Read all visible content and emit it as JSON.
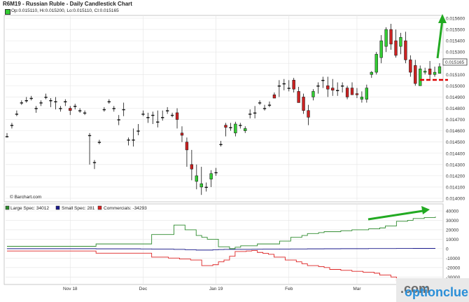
{
  "header": {
    "title": "R6M19 - Russian Ruble - Daily Candlestick Chart",
    "ohlc": "Op:0.015110, Hi:0.015200, Lo:0.015110, Cl:0.015165"
  },
  "price_tag": "0.015165",
  "credit": "© Barchart.com",
  "watermark": {
    "brand": "optionclue",
    "tld": ".com"
  },
  "colors": {
    "up": "#33cc33",
    "down": "#cc2222",
    "large_spec": "#2e8b2e",
    "small_spec": "#1a1a8c",
    "commercials": "#dd2222",
    "arrow": "#22aa22",
    "support": "#dd0000"
  },
  "chart_data": [
    {
      "type": "candlestick",
      "title": "R6M19 - Russian Ruble - Daily Candlestick Chart",
      "x_tick_labels": [
        "Nov 18",
        "Dec",
        "Jan 19",
        "Feb",
        "Mar"
      ],
      "ylim": [
        0.014,
        0.0156
      ],
      "y_ticks": [
        "0.015600",
        "0.015500",
        "0.015400",
        "0.015300",
        "0.015200",
        "0.015100",
        "0.015000",
        "0.014900",
        "0.014800",
        "0.014700",
        "0.014600",
        "0.014500",
        "0.014400",
        "0.014300",
        "0.014200",
        "0.014100",
        "0.014000"
      ],
      "grid": true,
      "ohlc": [
        [
          0.01455,
          0.01458,
          0.01454,
          0.01455
        ],
        [
          0.01465,
          0.01467,
          0.01462,
          0.01465
        ],
        [
          0.01475,
          0.01478,
          0.01473,
          0.01475
        ],
        [
          0.01485,
          0.01487,
          0.01483,
          0.01485
        ],
        [
          0.01487,
          0.0149,
          0.01485,
          0.01487
        ],
        [
          0.01489,
          0.01491,
          0.01487,
          0.01489
        ],
        [
          0.0148,
          0.01482,
          0.01476,
          0.0148
        ],
        [
          0.01485,
          0.01487,
          0.01482,
          0.01485
        ],
        [
          0.0149,
          0.01493,
          0.01488,
          0.0149
        ],
        [
          0.01487,
          0.01489,
          0.01481,
          0.01487
        ],
        [
          0.01486,
          0.0149,
          0.01479,
          0.01486
        ],
        [
          0.0148,
          0.01482,
          0.01477,
          0.0148
        ],
        [
          0.01486,
          0.01488,
          0.01482,
          0.01486
        ],
        [
          0.0148,
          0.01482,
          0.01474,
          0.01478
        ],
        [
          0.01482,
          0.01484,
          0.01479,
          0.01482
        ],
        [
          0.01478,
          0.0148,
          0.01476,
          0.01478
        ],
        [
          0.01476,
          0.01478,
          0.01474,
          0.01476
        ],
        [
          0.01456,
          0.01458,
          0.0143,
          0.01456
        ],
        [
          0.01432,
          0.01434,
          0.01426,
          0.01432
        ],
        [
          0.0145,
          0.01452,
          0.01448,
          0.0145
        ],
        [
          0.01479,
          0.01481,
          0.01477,
          0.01479
        ],
        [
          0.01486,
          0.01488,
          0.01484,
          0.01486
        ],
        [
          0.0148,
          0.01482,
          0.01477,
          0.0148
        ],
        [
          0.0147,
          0.01474,
          0.01465,
          0.0147
        ],
        [
          0.01479,
          0.01485,
          0.01473,
          0.01479
        ],
        [
          0.01452,
          0.01454,
          0.01447,
          0.01452
        ],
        [
          0.01452,
          0.01462,
          0.01446,
          0.01452
        ],
        [
          0.0146,
          0.01466,
          0.01456,
          0.0146
        ],
        [
          0.01475,
          0.01478,
          0.01473,
          0.01475
        ],
        [
          0.01472,
          0.01476,
          0.01467,
          0.01472
        ],
        [
          0.01474,
          0.01477,
          0.01466,
          0.01474
        ],
        [
          0.01468,
          0.01478,
          0.01463,
          0.01468
        ],
        [
          0.01472,
          0.01478,
          0.01469,
          0.01472
        ],
        [
          0.01478,
          0.01481,
          0.01475,
          0.01478
        ],
        [
          0.01474,
          0.01476,
          0.01472,
          0.01474
        ],
        [
          0.01476,
          0.0148,
          0.01462,
          0.0147
        ],
        [
          0.01458,
          0.01464,
          0.0145,
          0.01456
        ],
        [
          0.0145,
          0.01454,
          0.01428,
          0.01443
        ],
        [
          0.0143,
          0.01443,
          0.01416,
          0.01426
        ],
        [
          0.01415,
          0.0143,
          0.01408,
          0.0142
        ],
        [
          0.0141,
          0.01428,
          0.01403,
          0.01413
        ],
        [
          0.0141,
          0.01414,
          0.01406,
          0.0141
        ],
        [
          0.01417,
          0.01425,
          0.0141,
          0.01422
        ],
        [
          0.01423,
          0.01427,
          0.0142,
          0.01423
        ],
        [
          0.01448,
          0.01451,
          0.01446,
          0.01448
        ],
        [
          0.01465,
          0.01467,
          0.01455,
          0.01463
        ],
        [
          0.01463,
          0.01467,
          0.0146,
          0.01463
        ],
        [
          0.01458,
          0.01468,
          0.01455,
          0.01466
        ],
        [
          0.01465,
          0.01467,
          0.01462,
          0.01465
        ],
        [
          0.0146,
          0.01464,
          0.01458,
          0.01462
        ],
        [
          0.01475,
          0.01479,
          0.01471,
          0.01475
        ],
        [
          0.01476,
          0.01482,
          0.01471,
          0.01476
        ],
        [
          0.01485,
          0.01487,
          0.01483,
          0.01485
        ],
        [
          0.0148,
          0.01483,
          0.01478,
          0.0148
        ],
        [
          0.01483,
          0.01486,
          0.01481,
          0.01483
        ],
        [
          0.01492,
          0.01494,
          0.01489,
          0.01489
        ],
        [
          0.015,
          0.01505,
          0.0149,
          0.015
        ],
        [
          0.01502,
          0.01506,
          0.01496,
          0.01502
        ],
        [
          0.01498,
          0.01505,
          0.01495,
          0.01498
        ],
        [
          0.01505,
          0.01507,
          0.01494,
          0.01497
        ],
        [
          0.01495,
          0.01499,
          0.01485,
          0.01485
        ],
        [
          0.0149,
          0.01493,
          0.01475,
          0.01478
        ],
        [
          0.01478,
          0.01483,
          0.01465,
          0.01472
        ],
        [
          0.0149,
          0.01497,
          0.01487,
          0.01495
        ],
        [
          0.015,
          0.01503,
          0.01493,
          0.015
        ],
        [
          0.01505,
          0.01508,
          0.01498,
          0.01505
        ],
        [
          0.015,
          0.01508,
          0.0149,
          0.01497
        ],
        [
          0.01498,
          0.01506,
          0.01491,
          0.01496
        ],
        [
          0.01496,
          0.01503,
          0.01491,
          0.01496
        ],
        [
          0.015,
          0.01503,
          0.01494,
          0.015
        ],
        [
          0.01498,
          0.015,
          0.01488,
          0.0149
        ],
        [
          0.01498,
          0.01503,
          0.01492,
          0.01492
        ],
        [
          0.01493,
          0.01498,
          0.01489,
          0.01492
        ],
        [
          0.01488,
          0.01495,
          0.01485,
          0.0149
        ],
        [
          0.01488,
          0.01501,
          0.01485,
          0.01498
        ],
        [
          0.0151,
          0.01513,
          0.01507,
          0.01512
        ],
        [
          0.01512,
          0.0153,
          0.0151,
          0.01528
        ],
        [
          0.01525,
          0.01545,
          0.0152,
          0.0154
        ],
        [
          0.01535,
          0.01552,
          0.0153,
          0.0155
        ],
        [
          0.0155,
          0.01555,
          0.01532,
          0.01537
        ],
        [
          0.0154,
          0.0155,
          0.01525,
          0.01527
        ],
        [
          0.01535,
          0.01547,
          0.01528,
          0.01543
        ],
        [
          0.0154,
          0.01548,
          0.0152,
          0.01523
        ],
        [
          0.01523,
          0.01527,
          0.01508,
          0.01512
        ],
        [
          0.01518,
          0.01523,
          0.015,
          0.01502
        ],
        [
          0.015,
          0.01518,
          0.015,
          0.01515
        ],
        [
          0.01512,
          0.01516,
          0.0151,
          0.01513
        ],
        [
          0.01515,
          0.01522,
          0.01506,
          0.0151
        ],
        [
          0.0151,
          0.01517,
          0.01508,
          0.01512
        ],
        [
          0.01511,
          0.0152,
          0.01511,
          0.01517
        ]
      ]
    },
    {
      "type": "step-line",
      "legend": [
        "Large Spec: 34012",
        "Small Spec: 281",
        "Commercials: -34293"
      ],
      "ylim": [
        -35000,
        40000
      ],
      "y_ticks": [
        "40000",
        "30000",
        "20000",
        "10000",
        "0",
        "-10000",
        "-20000",
        "-30000"
      ],
      "x_tick_labels": [
        "Nov 18",
        "Dec",
        "Jan 19",
        "Feb",
        "Mar"
      ],
      "series": [
        {
          "name": "Large Spec",
          "color": "#2e8b2e",
          "values": [
            2500,
            2500,
            2500,
            2500,
            2500,
            2500,
            2500,
            2500,
            2500,
            2500,
            2500,
            2500,
            2500,
            2500,
            2500,
            2500,
            5000,
            5000,
            5000,
            5000,
            5000,
            5000,
            5000,
            5000,
            5000,
            5000,
            15000,
            15000,
            15000,
            15000,
            25000,
            25000,
            20000,
            20000,
            14000,
            12000,
            10000,
            10000,
            2000,
            2000,
            0,
            1500,
            3000,
            3000,
            3000,
            5000,
            5000,
            5000,
            5000,
            8000,
            8000,
            12000,
            12000,
            14000,
            16000,
            16000,
            17000,
            18000,
            18000,
            18000,
            19000,
            19000,
            20000,
            20000,
            20000,
            21000,
            21000,
            22000,
            24000,
            24000,
            29000,
            29000,
            30000,
            32000,
            32000,
            33000,
            33000,
            34000
          ]
        },
        {
          "name": "Small Spec",
          "color": "#1a1a8c",
          "values": [
            0,
            0,
            0,
            0,
            0,
            0,
            0,
            0,
            0,
            0,
            0,
            0,
            0,
            0,
            0,
            0,
            -200,
            -200,
            -200,
            -200,
            -200,
            -200,
            -200,
            -200,
            -300,
            -300,
            -500,
            -500,
            -500,
            -500,
            -800,
            -800,
            -1200,
            -1200,
            -1500,
            -1500,
            -1500,
            -1200,
            -1000,
            -800,
            -800,
            -700,
            -800,
            -800,
            -700,
            -600,
            -500,
            -500,
            -500,
            -400,
            -400,
            -300,
            -300,
            -300,
            -200,
            -200,
            -200,
            -100,
            -100,
            -100,
            0,
            0,
            0,
            0,
            0,
            100,
            100,
            100,
            100,
            100,
            200,
            200,
            200,
            281,
            281,
            281,
            281,
            281
          ]
        },
        {
          "name": "Commercials",
          "color": "#dd2222",
          "values": [
            -2500,
            -2500,
            -2500,
            -2500,
            -2500,
            -2500,
            -2500,
            -2500,
            -2500,
            -2500,
            -2500,
            -2500,
            -2500,
            -2500,
            -2500,
            -2500,
            -4800,
            -4800,
            -4800,
            -4800,
            -4800,
            -4800,
            -4800,
            -4800,
            -4800,
            -4800,
            -9000,
            -9000,
            -9000,
            -10000,
            -10000,
            -11000,
            -11000,
            -12000,
            -12000,
            -18000,
            -18000,
            -17000,
            -14000,
            -12000,
            -8000,
            -3000,
            -3000,
            -2500,
            -2000,
            -4000,
            -5000,
            -6000,
            -9000,
            -9000,
            -12000,
            -12000,
            -14000,
            -16000,
            -18000,
            -18000,
            -19000,
            -20000,
            -22000,
            -22000,
            -23000,
            -23000,
            -24000,
            -24000,
            -25000,
            -25000,
            -26000,
            -28000,
            -28000,
            -30000,
            -34000,
            -34000,
            -34000,
            -34293,
            -34293,
            -34293,
            -34293,
            -34293
          ]
        }
      ]
    }
  ]
}
